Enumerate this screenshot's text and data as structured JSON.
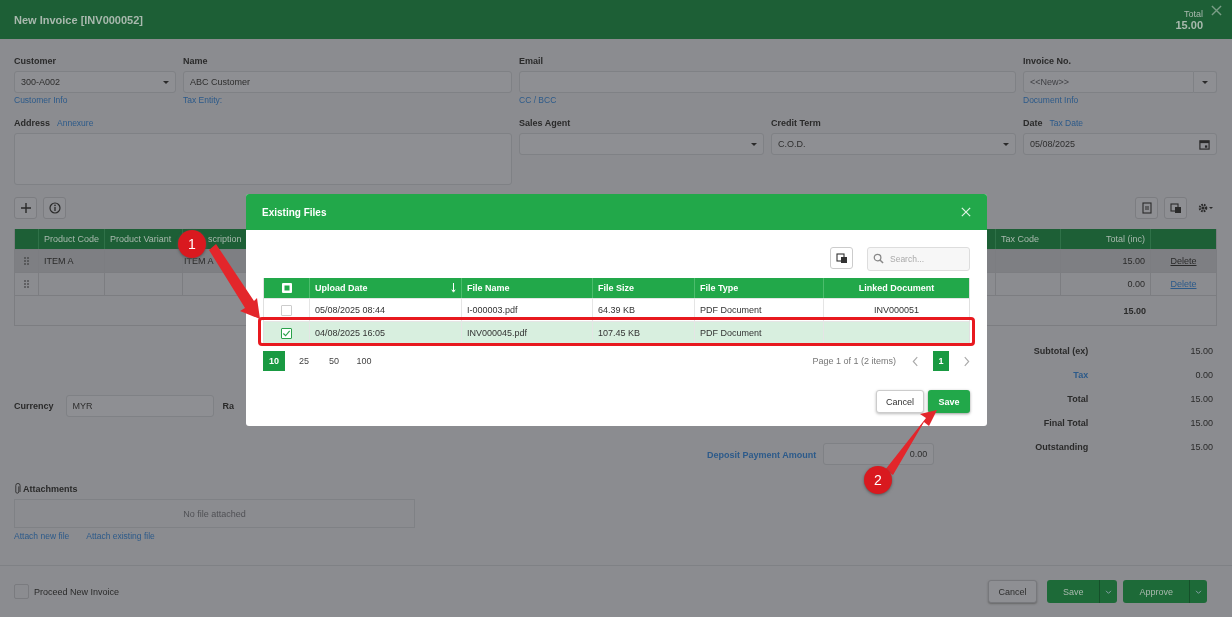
{
  "window": {
    "title": "New Invoice [INV000052]",
    "total_label": "Total",
    "total_value": "15.00"
  },
  "customer": {
    "label": "Customer",
    "value": "300-A002",
    "link": "Customer Info"
  },
  "name": {
    "label": "Name",
    "value": "ABC Customer",
    "link": "Tax Entity:"
  },
  "email": {
    "label": "Email",
    "link": "CC / BCC"
  },
  "invoice_no": {
    "label": "Invoice No.",
    "placeholder": "<<New>>",
    "link": "Document Info"
  },
  "address": {
    "label": "Address",
    "link": "Annexure"
  },
  "sales_agent": {
    "label": "Sales Agent"
  },
  "credit_term": {
    "label": "Credit Term",
    "value": "C.O.D."
  },
  "date": {
    "label": "Date",
    "link": "Tax Date",
    "value": "05/08/2025"
  },
  "items_table": {
    "columns": [
      "Product Code",
      "Product Variant",
      "scription",
      "Tax Code",
      "Total (inc)"
    ],
    "rows": [
      {
        "product_code": "ITEM A",
        "description": "ITEM A",
        "total": "15.00",
        "action": "Delete",
        "selected": true
      },
      {
        "total": "0.00",
        "action": "Delete",
        "selected": false
      }
    ],
    "footer_total": "15.00"
  },
  "currency": {
    "label": "Currency",
    "value": "MYR",
    "next_label": "Ra"
  },
  "deposit": {
    "label": "Deposit Payment Amount",
    "value": "0.00"
  },
  "totals": [
    {
      "label": "Subtotal (ex)",
      "value": "15.00",
      "kind": "plain"
    },
    {
      "label": "Tax",
      "value": "0.00",
      "kind": "link"
    },
    {
      "label": "Total",
      "value": "15.00",
      "kind": "plain"
    },
    {
      "label": "Final Total",
      "value": "15.00",
      "kind": "plain"
    },
    {
      "label": "Outstanding",
      "value": "15.00",
      "kind": "plain"
    }
  ],
  "attachments": {
    "title": "Attachments",
    "empty_text": "No file attached",
    "links": [
      "Attach new file",
      "Attach existing file"
    ]
  },
  "footer": {
    "proceed": {
      "label": "Proceed New Invoice",
      "checked": false
    },
    "buttons": [
      {
        "label": "Cancel",
        "kind": "plain"
      },
      {
        "label": "Save",
        "kind": "split"
      },
      {
        "label": "Approve",
        "kind": "split"
      }
    ]
  },
  "dialog": {
    "title": "Existing Files",
    "search": {
      "placeholder": "Search..."
    },
    "select_all_indeterminate": true,
    "columns": [
      {
        "label": "Upload Date",
        "sorted_descending": true
      },
      {
        "label": "File Name"
      },
      {
        "label": "File Size"
      },
      {
        "label": "File Type"
      },
      {
        "label": "Linked Document"
      }
    ],
    "rows": [
      {
        "checked": false,
        "upload_date": "05/08/2025 08:44",
        "file_name": "I-000003.pdf",
        "file_size": "64.39 KB",
        "file_type": "PDF Document",
        "linked_document": "INV000051"
      },
      {
        "checked": true,
        "upload_date": "04/08/2025 16:05",
        "file_name": "INV000045.pdf",
        "file_size": "107.45 KB",
        "file_type": "PDF Document"
      }
    ],
    "page_sizes": [
      {
        "label": "10",
        "selected": true
      },
      {
        "label": "25",
        "selected": false
      },
      {
        "label": "50",
        "selected": false
      },
      {
        "label": "100",
        "selected": false
      }
    ],
    "page_info": "Page 1 of 1 (2 items)",
    "pages": [
      {
        "label": "1",
        "selected": true
      }
    ],
    "buttons": [
      {
        "label": "Cancel",
        "kind": "secondary"
      },
      {
        "label": "Save",
        "kind": "primary"
      }
    ]
  },
  "annotations": [
    {
      "label": "1"
    },
    {
      "label": "2"
    }
  ]
}
